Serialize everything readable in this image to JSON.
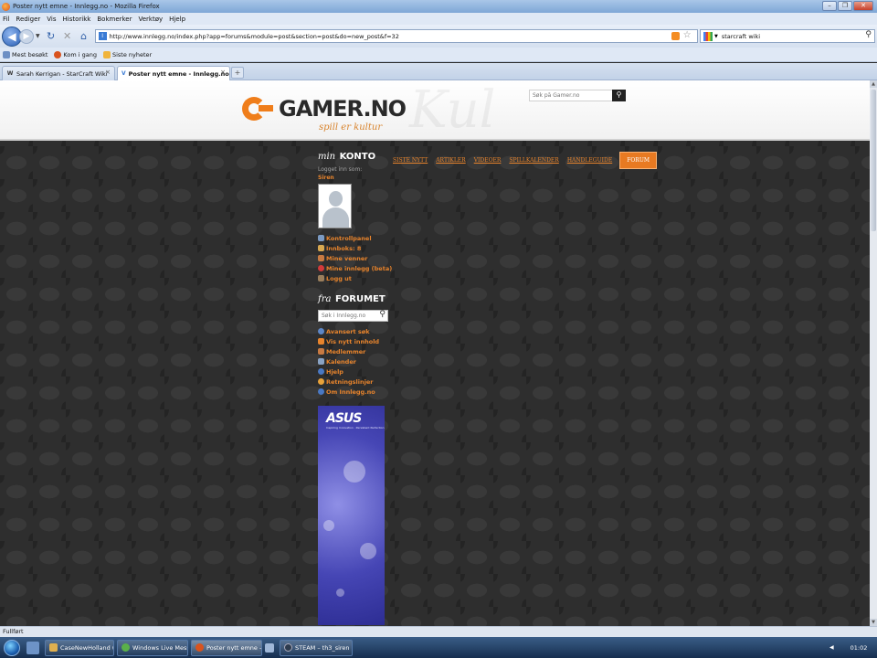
{
  "window": {
    "title": "Poster nytt emne - Innlegg.no - Mozilla Firefox"
  },
  "menu": [
    "Fil",
    "Rediger",
    "Vis",
    "Historikk",
    "Bokmerker",
    "Verktøy",
    "Hjelp"
  ],
  "nav": {
    "url": "http://www.innlegg.no/index.php?app=forums&module=post&section=post&do=new_post&f=32",
    "search_query": "starcraft wiki"
  },
  "bookmarks": [
    "Mest besøkt",
    "Kom i gang",
    "Siste nyheter"
  ],
  "tabs": [
    {
      "label": "Sarah Kerrigan - StarCraft Wiki - Sta...",
      "active": false
    },
    {
      "label": "Poster nytt emne - Innlegg.no",
      "active": true
    }
  ],
  "site": {
    "logo_text": "GAMER.NO",
    "tagline": "spill er kultur",
    "search_placeholder": "Søk på Gamer.no"
  },
  "topnav": [
    "SISTE NYTT",
    "ARTIKLER",
    "VIDEOER",
    "SPILLKALENDER",
    "HANDLEGUIDE",
    "FORUM"
  ],
  "account": {
    "title_prefix": "min",
    "title": "KONTO",
    "logged_in_label": "Logget inn som:",
    "username": "Siren",
    "links": [
      "Kontrollpanel",
      "Innboks: 8",
      "Mine venner",
      "Mine innlegg (beta)",
      "Logg ut"
    ]
  },
  "forum": {
    "title_prefix": "fra",
    "title": "FORUMET",
    "search_placeholder": "Søk i Innlegg.no",
    "links": [
      "Avansert søk",
      "Vis nytt innhold",
      "Medlemmer",
      "Kalender",
      "Hjelp",
      "Retningslinjer",
      "Om Innlegg.no"
    ]
  },
  "ad": {
    "brand": "ASUS",
    "slogan": "Inspiring Innovation · Persistent Perfection"
  },
  "status": "Fullført",
  "taskbar": {
    "items": [
      {
        "label": "CaseNewHolland (O...",
        "active": false
      },
      {
        "label": "Windows Live Messe...",
        "active": false
      },
      {
        "label": "Poster nytt emne - Inn...",
        "active": true
      },
      {
        "label": "STEAM – th3_siren",
        "active": false
      }
    ],
    "clock": "01:02"
  },
  "colors": {
    "accent": "#e8842c",
    "forum_button": "#e87a22",
    "page_bg": "#2e2e2e",
    "header_bg": "#ffffff"
  },
  "icons": [
    "firefox-icon",
    "back-icon",
    "forward-icon",
    "reload-icon",
    "stop-icon",
    "home-icon",
    "rss-icon",
    "star-icon",
    "search-icon",
    "windows-orb-icon"
  ]
}
